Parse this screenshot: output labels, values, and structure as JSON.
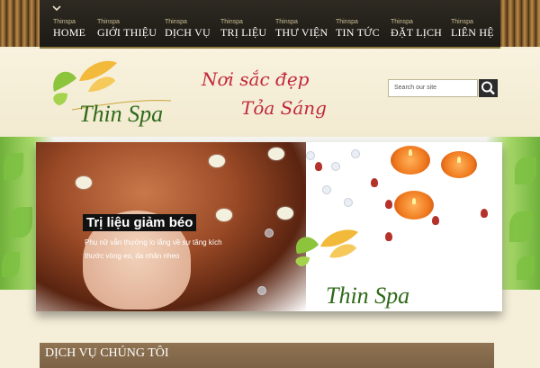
{
  "nav": {
    "items": [
      {
        "small": "Thinspa",
        "label": "HOME"
      },
      {
        "small": "Thinspa",
        "label": "GIỚI THIỆU"
      },
      {
        "small": "Thinspa",
        "label": "DỊCH VỤ"
      },
      {
        "small": "Thinspa",
        "label": "TRỊ LIỆU"
      },
      {
        "small": "Thinspa",
        "label": "THƯ VIỆN"
      },
      {
        "small": "Thinspa",
        "label": "TIN TỨC"
      },
      {
        "small": "Thinspa",
        "label": "ĐẶT LỊCH"
      },
      {
        "small": "Thinspa",
        "label": "LIÊN HỆ"
      }
    ]
  },
  "header": {
    "logo_text": "Thin Spa",
    "slogan_line1": "Nơi sắc đẹp",
    "slogan_line2": "Tỏa Sáng",
    "search_placeholder": "Search our site"
  },
  "banner": {
    "title": "Trị liệu giảm béo",
    "description": "Phụ nữ vẫn thường lo lắng về sự tăng kích thước vòng eo, da nhăn nheo",
    "logo_text": "Thin Spa"
  },
  "section": {
    "title": "DỊCH VỤ CHÚNG TÔI"
  },
  "colors": {
    "nav_bg": "#1c1a15",
    "slogan": "#c2273a",
    "logo_green": "#2f6a1a",
    "section_bar": "#8f7352"
  },
  "icons": {
    "menu_toggle": "chevron-down-icon",
    "search": "search-icon"
  }
}
